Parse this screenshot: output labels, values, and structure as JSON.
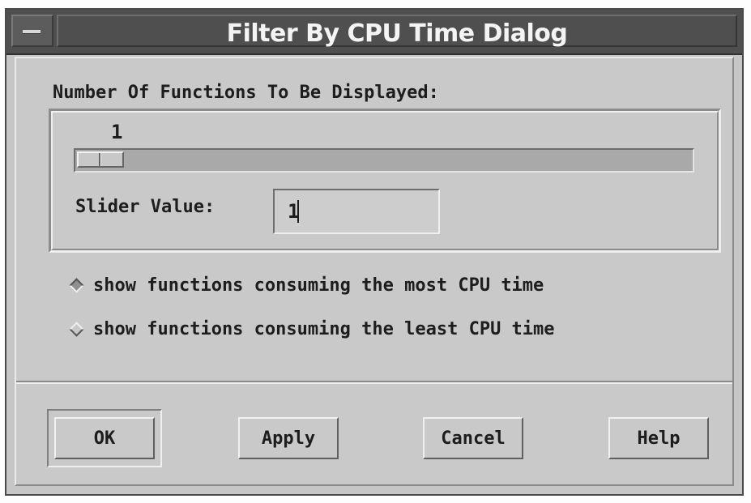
{
  "window": {
    "title": "Filter By CPU Time Dialog"
  },
  "slider": {
    "label": "Number Of Functions To Be Displayed:",
    "readout": "1",
    "value": 1,
    "min": 1,
    "max": 100,
    "value_label": "Slider Value:",
    "field_value": "1"
  },
  "options": {
    "most": {
      "label": "show functions consuming the most CPU time",
      "selected": true
    },
    "least": {
      "label": "show functions consuming the least CPU time",
      "selected": false
    }
  },
  "buttons": {
    "ok": "OK",
    "apply": "Apply",
    "cancel": "Cancel",
    "help": "Help"
  }
}
